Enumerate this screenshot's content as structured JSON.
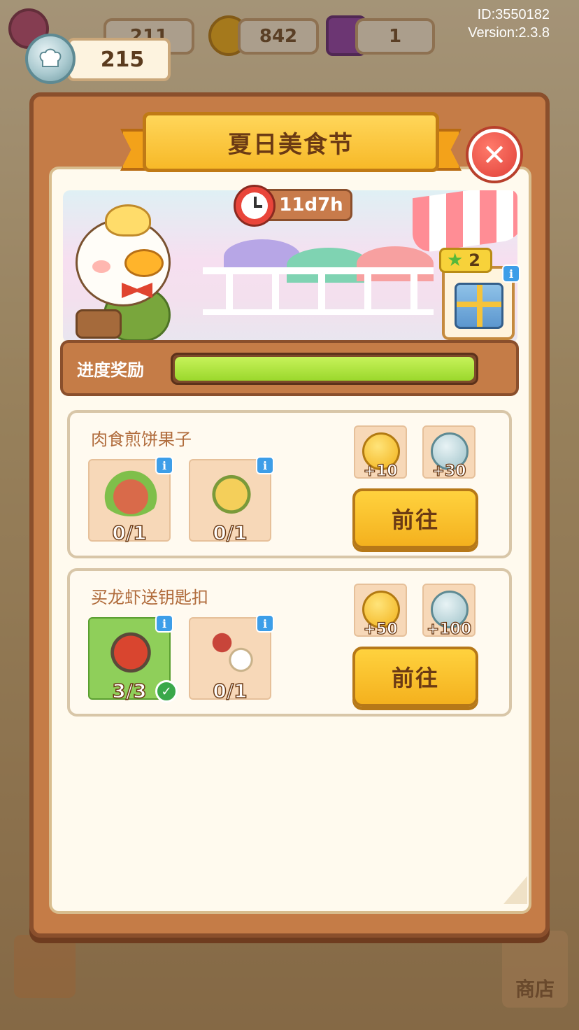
{
  "hud": {
    "energy_value": "211",
    "coins_value": "842",
    "gems_value": "1",
    "chef_tokens": "215",
    "id_text": "ID:3550182",
    "version_text": "Version:2.3.8"
  },
  "dialog": {
    "title": "夏日美食节",
    "timer": "11d7h",
    "gift_stars": "2",
    "progress_label": "进度奖励",
    "progress_fraction": 1.0,
    "close_icon": "close-icon"
  },
  "tasks": [
    {
      "title": "肉食煎饼果子",
      "items": [
        {
          "icon": "meat-platter-icon",
          "count": "0/1",
          "done": false
        },
        {
          "icon": "jianbing-icon",
          "count": "0/1",
          "done": false
        }
      ],
      "rewards": [
        {
          "type": "gold-coin",
          "amount": "+10"
        },
        {
          "type": "chef-token",
          "amount": "+30"
        }
      ],
      "button": "前往"
    },
    {
      "title": "买龙虾送钥匙扣",
      "items": [
        {
          "icon": "lobster-plate-icon",
          "count": "3/3",
          "done": true
        },
        {
          "icon": "keychain-icon",
          "count": "0/1",
          "done": false
        }
      ],
      "rewards": [
        {
          "type": "gold-coin",
          "amount": "+50"
        },
        {
          "type": "chef-token",
          "amount": "+100"
        }
      ],
      "button": "前往"
    }
  ],
  "bottom": {
    "shop_label": "商店"
  },
  "colors": {
    "accent_yellow": "#f7b928",
    "frame_brown": "#c57c47",
    "progress_green": "#9bd82c",
    "info_blue": "#3d9ee8"
  }
}
